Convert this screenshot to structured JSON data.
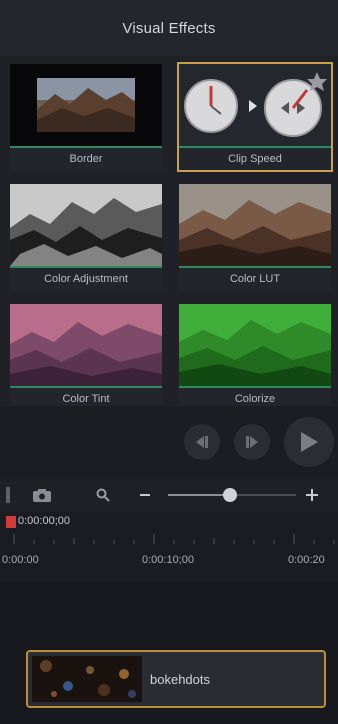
{
  "header": {
    "title": "Visual Effects"
  },
  "effects": [
    {
      "label": "Border"
    },
    {
      "label": "Clip Speed"
    },
    {
      "label": "Color Adjustment"
    },
    {
      "label": "Color LUT"
    },
    {
      "label": "Color Tint"
    },
    {
      "label": "Colorize"
    }
  ],
  "timeline": {
    "current_time": "0:00:00;00",
    "ticks": [
      "0:00:00",
      "0:00:10;00",
      "0:00:20"
    ]
  },
  "clip": {
    "name": "bokehdots"
  },
  "colors": {
    "accent_selected": "#c8a24a",
    "tile_bar": "#2f8a5e",
    "playhead": "#d23b3b"
  },
  "icons": [
    "prev-frame-icon",
    "next-frame-icon",
    "play-icon",
    "camera-icon",
    "zoom-icon",
    "minus-icon",
    "plus-icon",
    "star-icon"
  ]
}
